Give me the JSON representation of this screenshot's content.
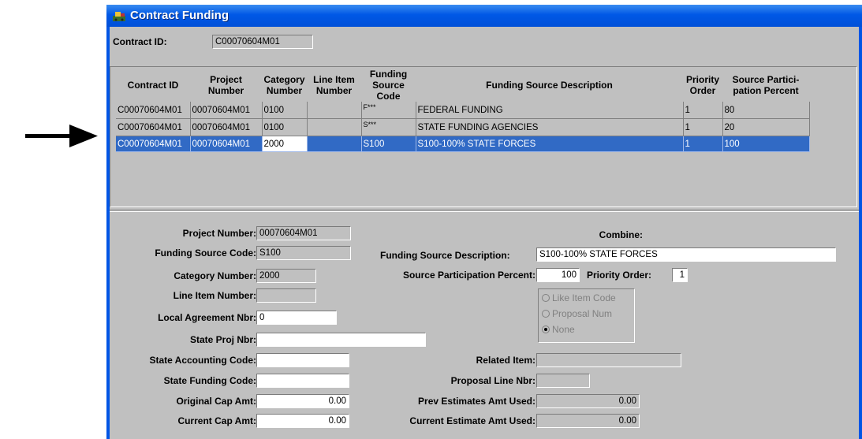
{
  "window": {
    "title": "Contract Funding"
  },
  "header": {
    "contract_id_label": "Contract ID:",
    "contract_id_value": "C00070604M01"
  },
  "grid": {
    "columns": [
      [
        "Contract ID"
      ],
      [
        "Project",
        "Number"
      ],
      [
        "Category",
        "Number"
      ],
      [
        "Line Item",
        "Number"
      ],
      [
        "Funding",
        "Source Code"
      ],
      [
        "Funding Source Description"
      ],
      [
        "Priority",
        "Order"
      ],
      [
        "Source Partici-",
        "pation Percent"
      ]
    ],
    "rows": [
      [
        "C00070604M01",
        "00070604M01",
        "0100",
        "",
        "F***",
        "FEDERAL FUNDING",
        "1",
        "80"
      ],
      [
        "C00070604M01",
        "00070604M01",
        "0100",
        "",
        "S***",
        "STATE FUNDING AGENCIES",
        "1",
        "20"
      ],
      [
        "C00070604M01",
        "00070604M01",
        "2000",
        "",
        "S100",
        "S100-100% STATE FORCES",
        "1",
        "100"
      ]
    ],
    "selected_row": 2
  },
  "detail": {
    "project_number": {
      "label": "Project Number:",
      "value": "00070604M01"
    },
    "funding_source_code": {
      "label": "Funding Source Code:",
      "value": "S100"
    },
    "category_number": {
      "label": "Category Number:",
      "value": "2000"
    },
    "line_item_number": {
      "label": "Line Item Number:",
      "value": ""
    },
    "local_agreement_nbr": {
      "label": "Local Agreement Nbr:",
      "value": "0"
    },
    "state_proj_nbr": {
      "label": "State Proj Nbr:",
      "value": ""
    },
    "state_accounting_code": {
      "label": "State Accounting Code:",
      "value": ""
    },
    "state_funding_code": {
      "label": "State Funding Code:",
      "value": ""
    },
    "original_cap_amt": {
      "label": "Original Cap Amt:",
      "value": "0.00"
    },
    "current_cap_amt": {
      "label": "Current Cap Amt:",
      "value": "0.00"
    },
    "funding_source_description": {
      "label": "Funding Source Description:",
      "value": "S100-100% STATE FORCES"
    },
    "source_participation_percent": {
      "label": "Source Participation Percent:",
      "value": "100"
    },
    "priority_order": {
      "label": "Priority Order:",
      "value": "1"
    },
    "combine": {
      "label": "Combine:",
      "options": [
        "Like Item Code",
        "Proposal Num",
        "None"
      ],
      "selected": "None"
    },
    "related_item": {
      "label": "Related Item:",
      "value": ""
    },
    "proposal_line_nbr": {
      "label": "Proposal Line Nbr:",
      "value": ""
    },
    "prev_estimates_amt_used": {
      "label": "Prev Estimates Amt Used:",
      "value": "0.00"
    },
    "current_estimate_amt_used": {
      "label": "Current Estimate Amt Used:",
      "value": "0.00"
    }
  },
  "colors": {
    "title_bar": "#0058e6",
    "selection": "#316ac5",
    "panel": "#c0c0c0"
  }
}
